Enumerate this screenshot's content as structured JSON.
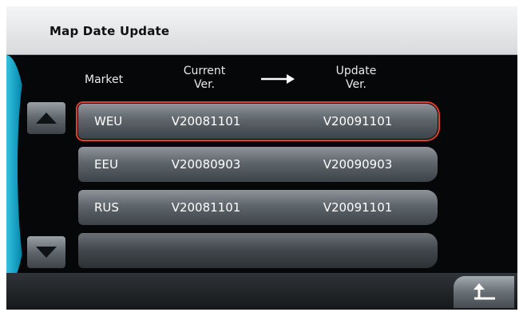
{
  "title": "Map Date Update",
  "headers": {
    "market": "Market",
    "current_l1": "Current",
    "current_l2": "Ver.",
    "update_l1": "Update",
    "update_l2": "Ver."
  },
  "rows": [
    {
      "market": "WEU",
      "current": "V20081101",
      "update": "V20091101",
      "selected": true
    },
    {
      "market": "EEU",
      "current": "V20080903",
      "update": "V20090903",
      "selected": false
    },
    {
      "market": "RUS",
      "current": "V20081101",
      "update": "V20091101",
      "selected": false
    }
  ],
  "icons": {
    "scroll_up": "triangle-up-icon",
    "scroll_down": "triangle-down-icon",
    "header_arrow": "arrow-right-icon",
    "back": "back-return-icon"
  },
  "colors": {
    "selection": "#e0402c",
    "accent": "#1aa6c8"
  }
}
